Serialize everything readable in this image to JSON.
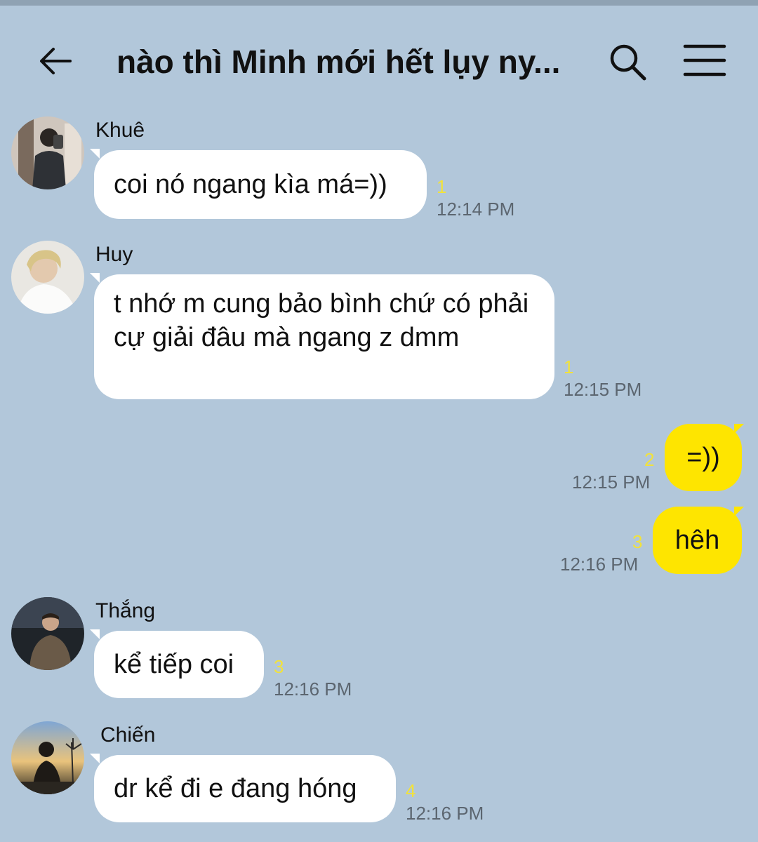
{
  "header": {
    "title": "nào thì Minh mới hết lụy ny...",
    "back_icon": "arrow-left-icon",
    "search_icon": "search-icon",
    "menu_icon": "hamburger-menu-icon"
  },
  "colors": {
    "background": "#b2c7da",
    "incoming_bubble": "#ffffff",
    "outgoing_bubble": "#fee500",
    "unread_count": "#f2e23a"
  },
  "messages": [
    {
      "sender": "Khuê",
      "text": "coi nó ngang kìa má=))",
      "unread": "1",
      "time": "12:14 PM"
    },
    {
      "sender": "Huy",
      "text": "t nhớ m cung bảo bình chứ có phải cự giải đâu mà ngang z dmm",
      "unread": "1",
      "time": "12:15 PM"
    },
    {
      "sender": "",
      "text": "=))",
      "unread": "2",
      "time": "12:15 PM"
    },
    {
      "sender": "",
      "text": "hêh",
      "unread": "3",
      "time": "12:16 PM"
    },
    {
      "sender": "Thắng",
      "text": "kể tiếp coi",
      "unread": "3",
      "time": "12:16 PM"
    },
    {
      "sender": "Chiến",
      "text": "dr kể đi e đang hóng",
      "unread": "4",
      "time": "12:16 PM"
    }
  ]
}
